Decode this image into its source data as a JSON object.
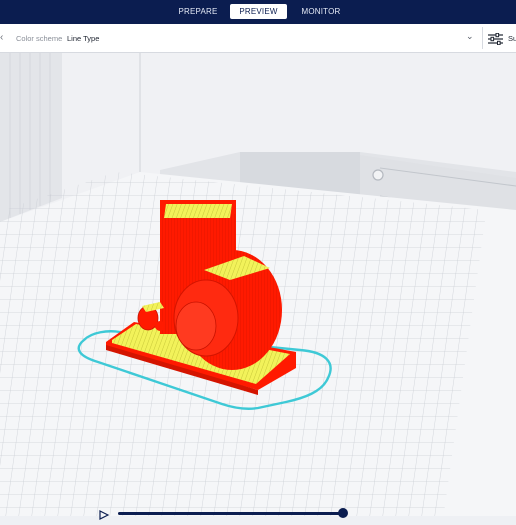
{
  "header": {
    "tabs": [
      {
        "label": "PREPARE",
        "active": false
      },
      {
        "label": "PREVIEW",
        "active": true
      },
      {
        "label": "MONITOR",
        "active": false
      }
    ]
  },
  "toolbar": {
    "color_scheme_label": "Color scheme",
    "color_scheme_value": "Line Type",
    "settings_label": "Su"
  },
  "colors": {
    "header_bg": "#0b1d50",
    "model_wall": "#ff1a00",
    "model_infill": "#f2f25a",
    "skirt": "#3ec9d6",
    "build_plate": "#f2f3f5"
  },
  "icons": [
    "chevron-left-icon",
    "chevron-down-icon",
    "settings-sliders-icon",
    "play-icon"
  ]
}
